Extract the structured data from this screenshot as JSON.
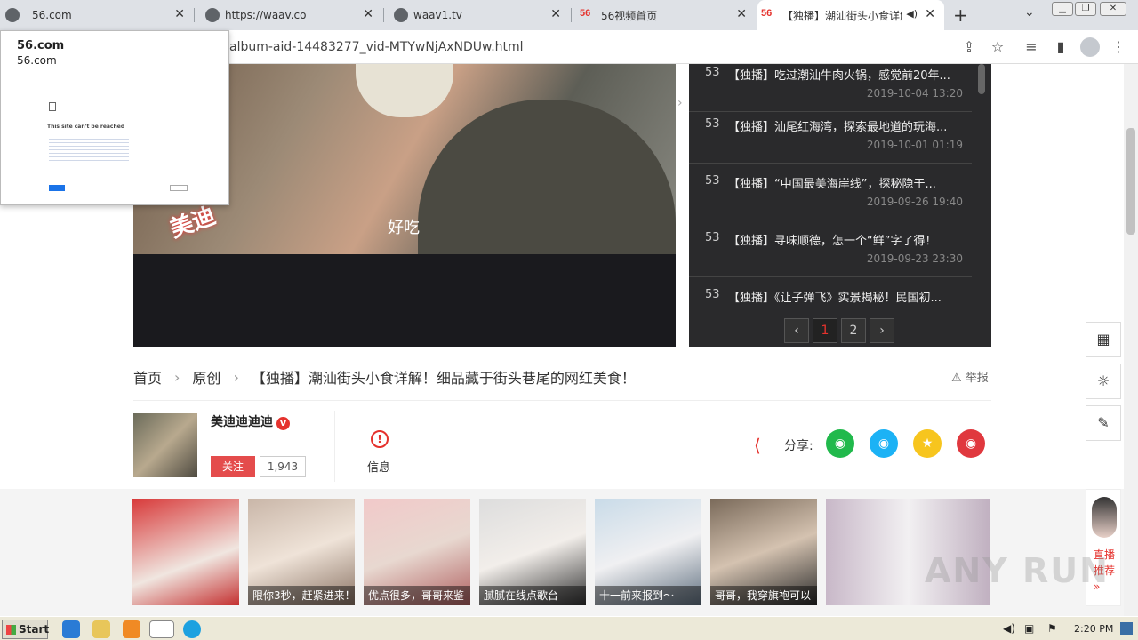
{
  "browser": {
    "tabs": [
      {
        "title": "56.com"
      },
      {
        "title": "https://waav.co"
      },
      {
        "title": "waav1.tv"
      },
      {
        "title": "56视频首页"
      },
      {
        "title": "【独播】潮汕街头小食详解"
      }
    ],
    "url": "album-aid-14483277_vid-MTYwNjAxNDUw.html"
  },
  "popup": {
    "title": "56.com",
    "subtitle": "56.com",
    "error_title": "This site can't be reached"
  },
  "video": {
    "subtitle": "好吃",
    "watermark": "美迪"
  },
  "playlist": {
    "items": [
      {
        "num": "53",
        "title": "【独播】吃过潮汕牛肉火锅，感觉前20年...",
        "date": "2019-10-04 13:20"
      },
      {
        "num": "53",
        "title": "【独播】汕尾红海湾，探索最地道的玩海...",
        "date": "2019-10-01 01:19"
      },
      {
        "num": "53",
        "title": "【独播】“中国最美海岸线”，探秘隐于...",
        "date": "2019-09-26 19:40"
      },
      {
        "num": "53",
        "title": "【独播】寻味顺德，怎一个“鲜”字了得！",
        "date": "2019-09-23 23:30"
      },
      {
        "num": "53",
        "title": "【独播】《让子弹飞》实景揭秘！民国初...",
        "date": ""
      }
    ],
    "pages": [
      "1",
      "2"
    ],
    "current_page": "1"
  },
  "breadcrumb": {
    "home": "首页",
    "section": "原创",
    "title": "【独播】潮汕街头小食详解！细品藏于街头巷尾的网红美食！"
  },
  "report_label": "举报",
  "uploader": {
    "name": "美迪迪迪迪",
    "badge": "V",
    "follow_label": "关注",
    "followers": "1,943"
  },
  "info_label": "信息",
  "share": {
    "label": "分享:"
  },
  "recommend": [
    {
      "caption": ""
    },
    {
      "caption": "限你3秒，赶紧进来！"
    },
    {
      "caption": "优点很多，哥哥来鉴"
    },
    {
      "caption": "腻腻在线点歌台"
    },
    {
      "caption": "十一前来报到～"
    },
    {
      "caption": "哥哥，我穿旗袍可以"
    },
    {
      "caption": ""
    }
  ],
  "live": {
    "label1": "直播",
    "label2": "推荐"
  },
  "watermark_text": "ANY RUN",
  "taskbar": {
    "start": "Start",
    "time": "2:20 PM"
  }
}
